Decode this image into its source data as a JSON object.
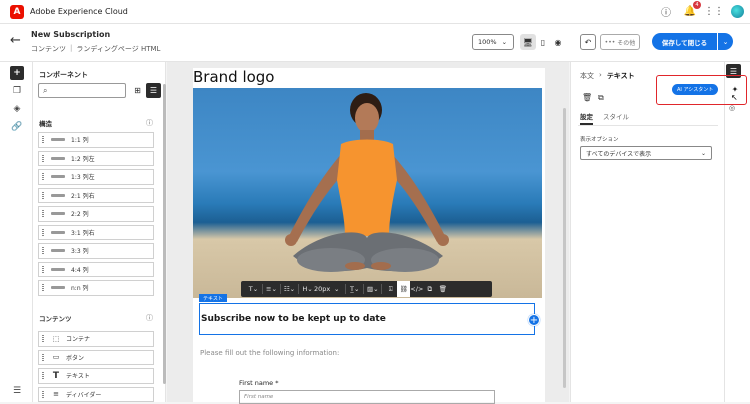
{
  "app": {
    "title": "Adobe Experience Cloud",
    "logo_letter": "A",
    "notification_count": "4"
  },
  "header": {
    "title": "New Subscription",
    "breadcrumb": [
      "コンテンツ",
      "ランディングページ HTML"
    ],
    "zoom": "100%",
    "more_label": "その他",
    "save_label": "保存して閉じる"
  },
  "components": {
    "title": "コンポーネント",
    "structure_heading": "構造",
    "structure_items": [
      "1:1 列",
      "1:2 列左",
      "1:3 列左",
      "2:1 列右",
      "2:2 列",
      "3:1 列右",
      "3:3 列",
      "4:4 列",
      "n:n 列"
    ],
    "content_heading": "コンテンツ",
    "content_items": [
      "コンテナ",
      "ボタン",
      "テキスト",
      "ディバイダー"
    ]
  },
  "canvas": {
    "brand_logo": "Brand logo",
    "text_tag": "テキスト",
    "toolbar_font_size": "20px",
    "subscribe_heading": "Subscribe now to be kept up to date",
    "instruction": "Please fill out the following information:",
    "first_name_label": "First name *",
    "first_name_placeholder": "First name"
  },
  "properties": {
    "breadcrumb_root": "本文",
    "breadcrumb_current": "テキスト",
    "tab_settings": "設定",
    "tab_style": "スタイル",
    "display_label": "表示オプション",
    "display_value": "すべてのデバイスで表示",
    "ai_assistant_label": "AI アシスタント"
  },
  "colors": {
    "accent": "#1473e6",
    "highlight": "#e0262b",
    "brand_red": "#eb1000"
  }
}
